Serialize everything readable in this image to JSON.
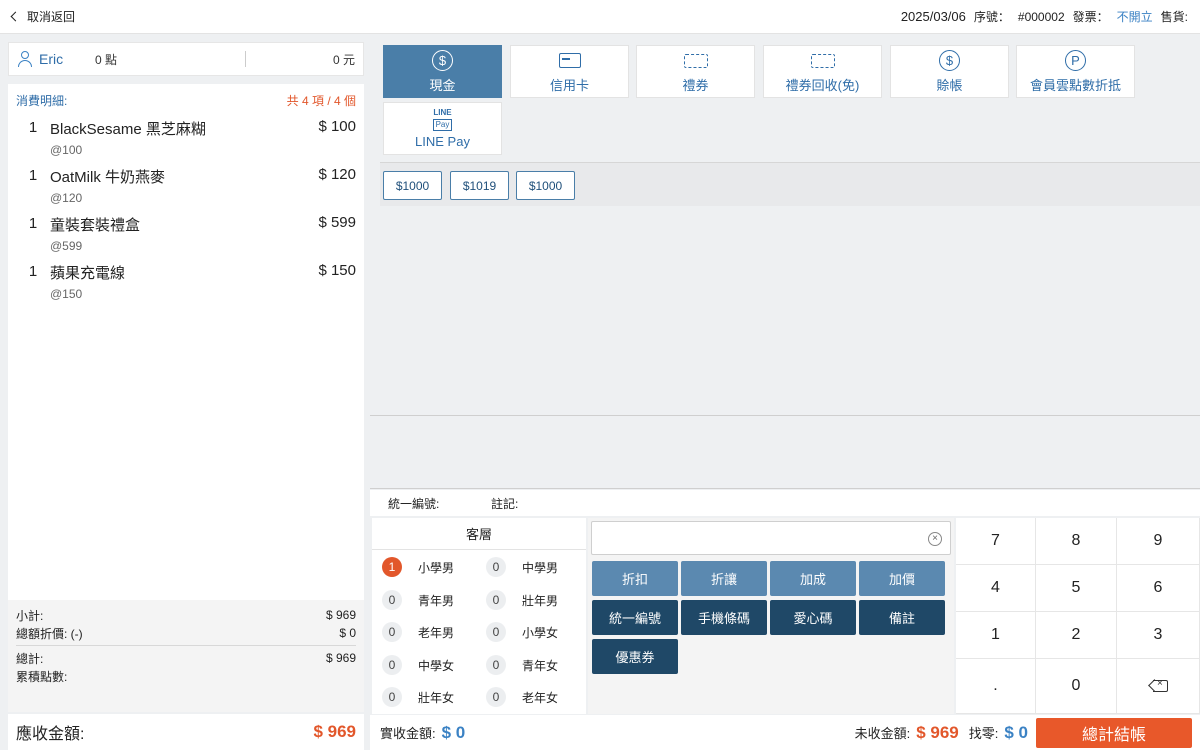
{
  "topbar": {
    "back_label": "取消返回",
    "date": "2025/03/06",
    "serial_label": "序號：",
    "serial_value": "#000002",
    "invoice_label": "發票：",
    "invoice_value": "不開立",
    "seller_label": "售貨:"
  },
  "member": {
    "name": "Eric",
    "points": "0 點",
    "credit": "0 元"
  },
  "order": {
    "title": "消費明細:",
    "count": "共 4 項 / 4 個",
    "items": [
      {
        "qty": "1",
        "name": "BlackSesame 黑芝麻糊",
        "unit": "@100",
        "price": "$ 100"
      },
      {
        "qty": "1",
        "name": "OatMilk 牛奶燕麥",
        "unit": "@120",
        "price": "$ 120"
      },
      {
        "qty": "1",
        "name": "童裝套裝禮盒",
        "unit": "@599",
        "price": "$ 599"
      },
      {
        "qty": "1",
        "name": "蘋果充電線",
        "unit": "@150",
        "price": "$ 150"
      }
    ]
  },
  "totals": {
    "subtotal_label": "小計:",
    "subtotal": "$ 969",
    "discount_label": "總額折價: (-)",
    "discount": "$ 0",
    "total_label": "總計:",
    "total": "$ 969",
    "points_label": "累積點數:"
  },
  "receivable": {
    "label": "應收金額:",
    "amount": "$ 969"
  },
  "payment_methods": [
    {
      "label": "現金",
      "icon": "dollar-circle-icon",
      "active": true
    },
    {
      "label": "信用卡",
      "icon": "credit-card-icon"
    },
    {
      "label": "禮券",
      "icon": "ticket-icon"
    },
    {
      "label": "禮券回收(免)",
      "icon": "ticket-icon"
    },
    {
      "label": "賒帳",
      "icon": "dollar-circle-icon"
    },
    {
      "label": "會員雲點數折抵",
      "icon": "points-p-icon"
    },
    {
      "label": "LINE Pay",
      "icon": "line-pay-icon",
      "logo_top": "LINE",
      "logo_box": "Pay"
    }
  ],
  "icon_glyphs": {
    "dollar": "$",
    "points": "P"
  },
  "quick_amounts": [
    "$1000",
    "$1019",
    "$1000"
  ],
  "info": {
    "tax_id_label": "統一編號:",
    "note_label": "註記:"
  },
  "segments": {
    "title": "客層",
    "items": [
      {
        "count": "1",
        "label": "小學男",
        "highlight": true
      },
      {
        "count": "0",
        "label": "中學男"
      },
      {
        "count": "0",
        "label": "青年男"
      },
      {
        "count": "0",
        "label": "壯年男"
      },
      {
        "count": "0",
        "label": "老年男"
      },
      {
        "count": "0",
        "label": "小學女"
      },
      {
        "count": "0",
        "label": "中學女"
      },
      {
        "count": "0",
        "label": "青年女"
      },
      {
        "count": "0",
        "label": "壯年女"
      },
      {
        "count": "0",
        "label": "老年女"
      }
    ]
  },
  "functions": {
    "search_value": "",
    "clear_glyph": "×",
    "row1": [
      "折扣",
      "折讓",
      "加成",
      "加價"
    ],
    "row2": [
      "統一編號",
      "手機條碼",
      "愛心碼",
      "備註"
    ],
    "row3": [
      "優惠券"
    ]
  },
  "keypad": [
    "7",
    "8",
    "9",
    "4",
    "5",
    "6",
    "1",
    "2",
    "3",
    ".",
    "0"
  ],
  "backspace_glyph": "×",
  "bottom": {
    "paid_label": "實收金額:",
    "paid": "$ 0",
    "unpaid_label": "未收金額:",
    "unpaid": "$ 969",
    "change_label": "找零:",
    "change": "$ 0",
    "checkout_label": "總計結帳"
  },
  "colors": {
    "accent_blue": "#4a7ea8",
    "dark_blue": "#1f4867",
    "orange": "#e2572b"
  }
}
